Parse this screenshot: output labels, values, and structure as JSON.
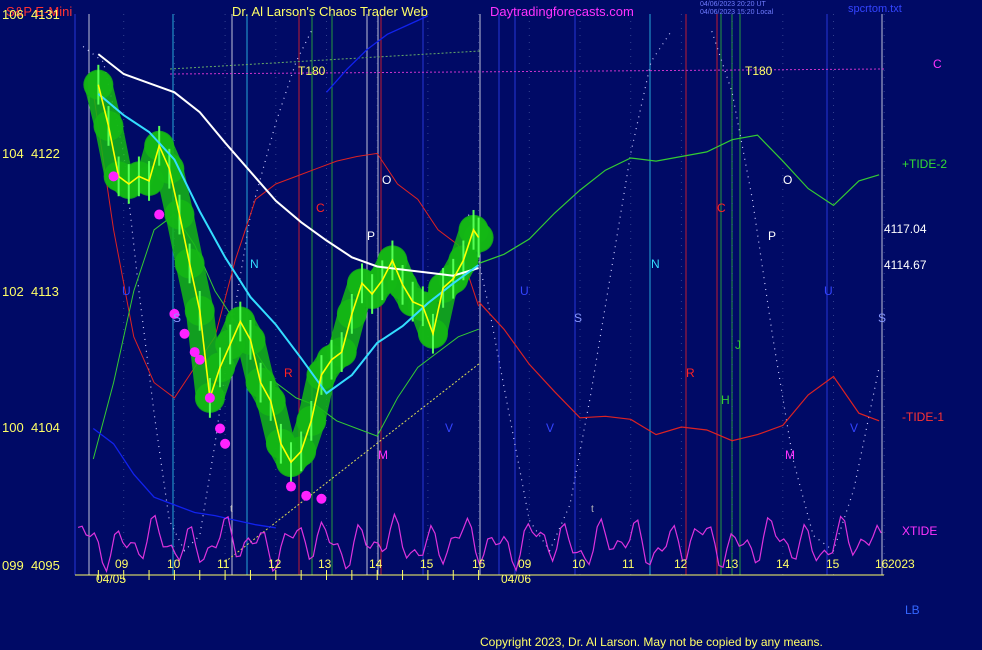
{
  "header": {
    "symbol": "S&P E-Mini",
    "title": "Dr. Al Larson's Chaos Trader Web",
    "site": "Daytradingforecasts.com",
    "ts1": "04/06/2023 20:20 UT",
    "ts2": "04/06/2023 15:20 Local",
    "file": "spcrtom.txt"
  },
  "copyright": "Copyright 2023, Dr. Al Larson. May not be copied by any means.",
  "year": "2023",
  "colors": {
    "background": "#000a66",
    "price_yellow": "#ffff00",
    "glow_green": "#14b814",
    "dot_magenta": "#ff22ff",
    "ma_white": "#ffffff",
    "ma_cyan": "#33ddff",
    "tide_plus": "#33cc33",
    "tide_minus": "#dd2222",
    "xtide": "#dd33dd"
  },
  "chart_data": {
    "type": "line",
    "title": "S&P E-Mini",
    "y_left_labels": [
      {
        "idx": "106",
        "price": "4131"
      },
      {
        "idx": "104",
        "price": "4122"
      },
      {
        "idx": "102",
        "price": "4113"
      },
      {
        "idx": "100",
        "price": "4104"
      },
      {
        "idx": "099",
        "price": "4095"
      }
    ],
    "ylim": [
      4095,
      4131
    ],
    "x_hour_labels": [
      "09",
      "10",
      "11",
      "12",
      "13",
      "14",
      "15",
      "16",
      "09",
      "10",
      "11",
      "12",
      "13",
      "14",
      "15",
      "16"
    ],
    "dates": [
      "04/05",
      "04/06"
    ],
    "right_labels": {
      "c": "C",
      "tide_plus": "+TIDE-2",
      "p1": "4117.04",
      "p2": "4114.67",
      "tide_minus": "-TIDE-1",
      "xtide": "XTIDE",
      "lb": "LB"
    },
    "t180_label": "T180",
    "price_series": {
      "name": "S&P E-Mini",
      "x": [
        8.5,
        8.7,
        8.9,
        9.1,
        9.3,
        9.5,
        9.7,
        9.9,
        10.1,
        10.3,
        10.5,
        10.7,
        10.9,
        11.1,
        11.3,
        11.5,
        11.7,
        11.9,
        12.1,
        12.3,
        12.5,
        12.7,
        12.9,
        13.1,
        13.3,
        13.5,
        13.7,
        13.9,
        14.1,
        14.3,
        14.5,
        14.7,
        14.9,
        15.1,
        15.3,
        15.5,
        15.7,
        15.9,
        16.0
      ],
      "y": [
        4126.5,
        4123.8,
        4120.5,
        4120.0,
        4120.5,
        4120.2,
        4122.5,
        4121.0,
        4118.0,
        4114.8,
        4111.7,
        4106.0,
        4108.0,
        4109.5,
        4111.0,
        4109.8,
        4107.0,
        4105.8,
        4103.0,
        4101.8,
        4102.5,
        4104.5,
        4107.5,
        4108.5,
        4109.0,
        4111.5,
        4113.5,
        4112.8,
        4113.7,
        4115.0,
        4113.4,
        4112.3,
        4112.0,
        4110.2,
        4113.2,
        4113.8,
        4115.0,
        4117.0,
        4116.5
      ]
    },
    "ma_white": {
      "name": "",
      "x": [
        8.5,
        9.0,
        9.5,
        10.0,
        10.5,
        11.0,
        11.5,
        12.0,
        12.5,
        13.0,
        13.5,
        14.0,
        14.5,
        15.0,
        15.5,
        16.0
      ],
      "y": [
        4128.5,
        4127.2,
        4126.6,
        4126.0,
        4124.7,
        4122.7,
        4120.8,
        4118.9,
        4117.5,
        4116.3,
        4115.2,
        4114.6,
        4114.4,
        4114.2,
        4114.0,
        4114.5
      ]
    },
    "ma_cyan": {
      "name": "",
      "x": [
        8.5,
        9.0,
        9.5,
        10.0,
        10.5,
        11.0,
        11.5,
        12.0,
        12.5,
        13.0,
        13.5,
        14.0,
        14.5,
        15.0,
        15.5,
        16.0
      ],
      "y": [
        4125.9,
        4124.5,
        4123.4,
        4121.6,
        4118.2,
        4115.2,
        4112.6,
        4110.8,
        4108.6,
        4106.3,
        4107.5,
        4109.6,
        4110.7,
        4112.2,
        4113.5,
        4114.7
      ]
    },
    "tide_plus_series": {
      "name": "+TIDE-2",
      "x": [
        16.0,
        16.5,
        17.0,
        17.5,
        18.0,
        18.5,
        19.0,
        19.5,
        20.0,
        20.5,
        21.0,
        21.5,
        22.0,
        22.5,
        23.0,
        23.5,
        23.9
      ],
      "y": [
        4114.8,
        4115.4,
        4116.4,
        4118.1,
        4119.6,
        4120.9,
        4121.7,
        4121.5,
        4121.8,
        4122.1,
        4122.9,
        4123.2,
        4121.5,
        4119.7,
        4118.6,
        4120.2,
        4120.6
      ]
    },
    "tide_minus_series": {
      "name": "-TIDE-1",
      "x": [
        16.0,
        16.5,
        17.0,
        17.5,
        18.0,
        18.5,
        19.0,
        19.5,
        20.0,
        20.5,
        21.0,
        21.5,
        22.0,
        22.5,
        23.0,
        23.5,
        23.9
      ],
      "y": [
        4112.3,
        4110.5,
        4108.2,
        4106.4,
        4104.7,
        4104.8,
        4104.6,
        4103.6,
        4104.1,
        4103.9,
        4103.2,
        4103.6,
        4104.2,
        4106.2,
        4107.4,
        4105.0,
        4104.5
      ]
    },
    "annotations": [
      "O",
      "C",
      "N",
      "U",
      "S",
      "R",
      "V",
      "M",
      "P",
      "H",
      "J",
      "t"
    ]
  }
}
